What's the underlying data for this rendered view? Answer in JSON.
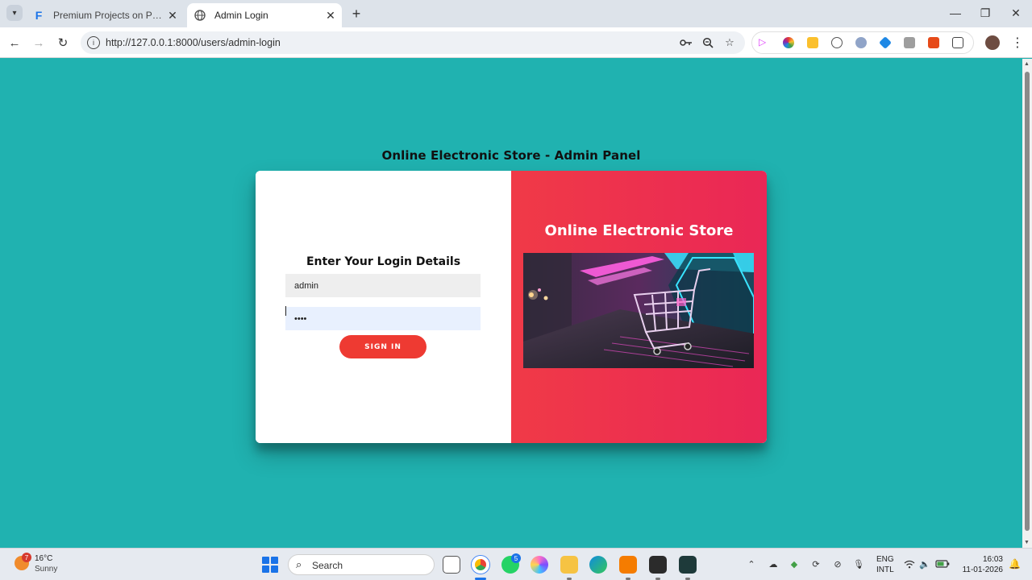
{
  "browser": {
    "tabs": [
      {
        "title": "Premium Projects on PHP, Java,",
        "favicon": "F",
        "active": false
      },
      {
        "title": "Admin Login",
        "favicon": "globe",
        "active": true
      }
    ],
    "url": "http://127.0.0.1:8000/users/admin-login"
  },
  "page": {
    "heading": "Online Electronic Store - Admin Panel",
    "login": {
      "title": "Enter Your Login Details",
      "username_value": "admin",
      "password_value": "••••",
      "signin_label": "SIGN IN"
    },
    "banner": {
      "title": "Online Electronic Store",
      "image": "shopping-cart-on-laptop-neon-image"
    }
  },
  "taskbar": {
    "weather": {
      "temp": "16°C",
      "desc": "Sunny",
      "badge": "7"
    },
    "search_label": "Search",
    "whatsapp_badge": "5",
    "language": {
      "line1": "ENG",
      "line2": "INTL"
    },
    "clock": {
      "time": "16:03",
      "date": "11-01-2026"
    }
  },
  "colors": {
    "page_bg": "#20b2b0",
    "banner_left": "#f03a47",
    "banner_right": "#ea2756",
    "signin_button": "#ee3a32"
  }
}
